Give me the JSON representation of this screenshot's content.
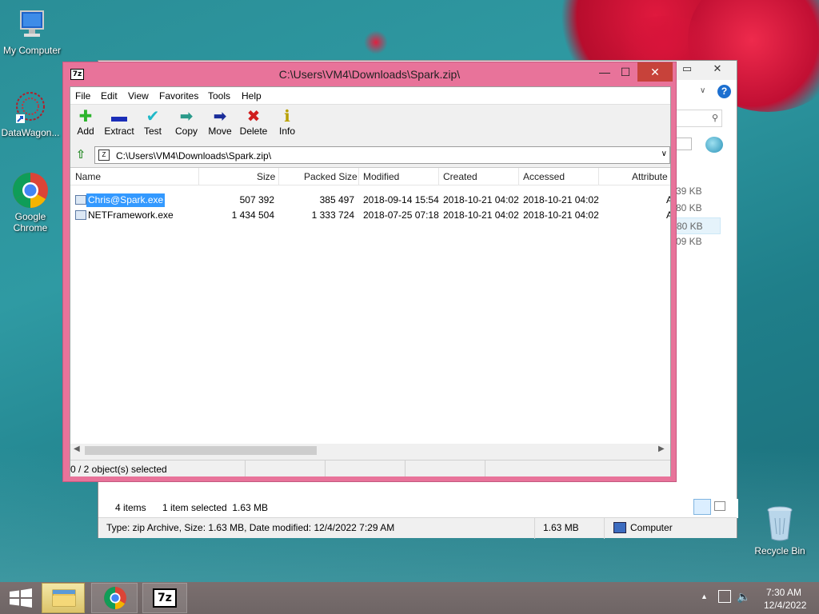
{
  "desktop": {
    "icons": [
      {
        "label": "My Computer",
        "icon": "monitor-icon"
      },
      {
        "label": "DataWagon...",
        "icon": "datawagon-icon"
      },
      {
        "label": "Google Chrome",
        "icon": "chrome-icon"
      },
      {
        "label": "Recycle Bin",
        "icon": "recycle-bin-icon"
      }
    ]
  },
  "explorer": {
    "status_items": "4 items",
    "status_selected": "1 item selected  1.63 MB",
    "details_text": "Type: zip Archive, Size: 1.63 MB, Date modified: 12/4/2022 7:29 AM",
    "details_size": "1.63 MB",
    "details_location": "Computer",
    "side_sizes": [
      "39 KB",
      "80 KB",
      "80 KB",
      "09 KB"
    ]
  },
  "zip": {
    "title": "C:\\Users\\VM4\\Downloads\\Spark.zip\\",
    "app_icon_label": "7z",
    "menu": [
      "File",
      "Edit",
      "View",
      "Favorites",
      "Tools",
      "Help"
    ],
    "toolbar": [
      {
        "label": "Add",
        "icon": "plus-icon",
        "glyph": "✚",
        "color": "#2db52d"
      },
      {
        "label": "Extract",
        "icon": "minus-icon",
        "glyph": "▬",
        "color": "#1a2db8"
      },
      {
        "label": "Test",
        "icon": "check-icon",
        "glyph": "✔",
        "color": "#1fb8c8"
      },
      {
        "label": "Copy",
        "icon": "copy-arrow-icon",
        "glyph": "➡",
        "color": "#2a9a8a"
      },
      {
        "label": "Move",
        "icon": "move-arrow-icon",
        "glyph": "➡",
        "color": "#1a2d9a"
      },
      {
        "label": "Delete",
        "icon": "delete-x-icon",
        "glyph": "✖",
        "color": "#d01e1e"
      },
      {
        "label": "Info",
        "icon": "info-icon",
        "glyph": "ℹ",
        "color": "#b8a000"
      }
    ],
    "address": "C:\\Users\\VM4\\Downloads\\Spark.zip\\",
    "columns": [
      "Name",
      "Size",
      "Packed Size",
      "Modified",
      "Created",
      "Accessed",
      "Attribute"
    ],
    "rows": [
      {
        "name": "Chris@Spark.exe",
        "size": "507 392",
        "packed": "385 497",
        "modified": "2018-09-14 15:54",
        "created": "2018-10-21 04:02",
        "accessed": "2018-10-21 04:02",
        "attr": "A",
        "selected": true
      },
      {
        "name": "NETFramework.exe",
        "size": "1 434 504",
        "packed": "1 333 724",
        "modified": "2018-07-25 07:18",
        "created": "2018-10-21 04:02",
        "accessed": "2018-10-21 04:02",
        "attr": "A",
        "selected": false
      }
    ],
    "status": "0 / 2 object(s) selected"
  },
  "taskbar": {
    "time": "7:30 AM",
    "date": "12/4/2022",
    "seven_zip_label": "7z"
  }
}
